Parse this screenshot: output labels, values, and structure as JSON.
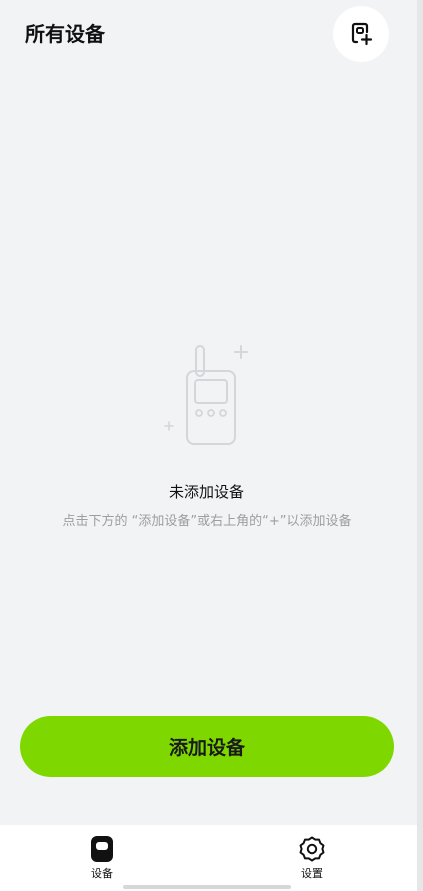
{
  "header": {
    "title": "所有设备",
    "add_icon": "add-device-icon"
  },
  "empty_state": {
    "illustration": "walkie-talkie-device-icon",
    "title": "未添加设备",
    "description": "点击下方的 “添加设备”或右上角的“+”以添加设备"
  },
  "primary_button": {
    "label": "添加设备",
    "color": "#7ED800"
  },
  "bottom_nav": {
    "items": [
      {
        "label": "设备",
        "icon": "device-icon",
        "active": true
      },
      {
        "label": "设置",
        "icon": "settings-gear-icon",
        "active": false
      }
    ]
  }
}
